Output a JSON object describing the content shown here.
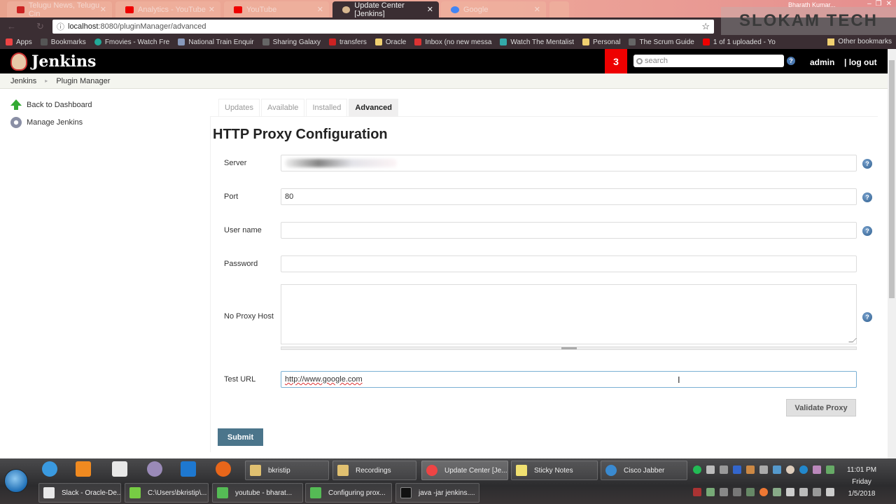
{
  "browser": {
    "tabs": [
      {
        "label": "Telugu News, Telugu Cin",
        "color": "#c22"
      },
      {
        "label": "Analytics - YouTube",
        "color": "#e00"
      },
      {
        "label": "YouTube",
        "color": "#e00"
      },
      {
        "label": "Update Center [Jenkins]",
        "color": "#d8b890",
        "active": true
      },
      {
        "label": "Google",
        "color": "#4285f4"
      }
    ],
    "profile": "Bharath Kumar...",
    "window_controls": [
      "–",
      "❐",
      "✕"
    ],
    "url_host": "localhost",
    "url_rest": ":8080/pluginManager/advanced",
    "info_icon": "ⓘ",
    "star": "☆",
    "bookmarks": [
      {
        "label": "Apps",
        "color": "#e44"
      },
      {
        "label": "Bookmarks",
        "color": "#555"
      },
      {
        "label": "Fmovies - Watch Fre",
        "color": "#2a9"
      },
      {
        "label": "National Train Enquir",
        "color": "#89b"
      },
      {
        "label": "Sharing Galaxy",
        "color": "#666"
      },
      {
        "label": "transfers",
        "color": "#c22"
      },
      {
        "label": "Oracle",
        "color": "#f0d070"
      },
      {
        "label": "Inbox (no new messa",
        "color": "#d33"
      },
      {
        "label": "Watch The Mentalist",
        "color": "#3aa"
      },
      {
        "label": "Personal",
        "color": "#f0d070"
      },
      {
        "label": "The Scrum Guide",
        "color": "#666"
      },
      {
        "label": "1 of 1 uploaded - Yo",
        "color": "#e00"
      }
    ],
    "other_bookmarks": "Other bookmarks",
    "watermark": "SLOKAM TECH"
  },
  "jenkins": {
    "logo_text": "Jenkins",
    "notification_count": "3",
    "search_placeholder": "search",
    "help": "?",
    "user": "admin",
    "logout": "| log out",
    "breadcrumb": [
      "Jenkins",
      "Plugin Manager"
    ],
    "breadcrumb_sep": "▸",
    "sidebar": [
      {
        "label": "Back to Dashboard",
        "icon": "up-arrow-icon"
      },
      {
        "label": "Manage Jenkins",
        "icon": "gear-icon"
      }
    ],
    "tabs": [
      "Updates",
      "Available",
      "Installed",
      "Advanced"
    ],
    "active_tab": "Advanced",
    "page_title": "HTTP Proxy Configuration",
    "form": {
      "server_label": "Server",
      "server_value": "",
      "port_label": "Port",
      "port_value": "80",
      "username_label": "User name",
      "username_value": "",
      "password_label": "Password",
      "password_value": "",
      "noproxy_label": "No Proxy Host",
      "noproxy_value": "",
      "testurl_label": "Test URL",
      "testurl_value": "http://www.google.com",
      "validate_button": "Validate Proxy",
      "submit_button": "Submit"
    }
  },
  "taskbar": {
    "row1": [
      {
        "label": "bkristip",
        "color": "#e0c070"
      },
      {
        "label": "Recordings",
        "color": "#e0c070"
      },
      {
        "label": "Update Center [Je...",
        "color": "#e44",
        "active": true
      },
      {
        "label": "Sticky Notes",
        "color": "#f0e070"
      },
      {
        "label": "Cisco Jabber",
        "color": "#3a8ad0"
      }
    ],
    "row2": [
      {
        "label": "Slack - Oracle-De...",
        "color": "#e8e8e8"
      },
      {
        "label": "C:\\Users\\bkristip\\...",
        "color": "#7c4"
      },
      {
        "label": "youtube - bharat...",
        "color": "#5b5"
      },
      {
        "label": "Configuring prox...",
        "color": "#5b5"
      },
      {
        "label": "java -jar jenkins....",
        "color": "#111"
      }
    ],
    "clock_time": "11:01 PM",
    "clock_day": "Friday",
    "clock_date": "1/5/2018"
  }
}
